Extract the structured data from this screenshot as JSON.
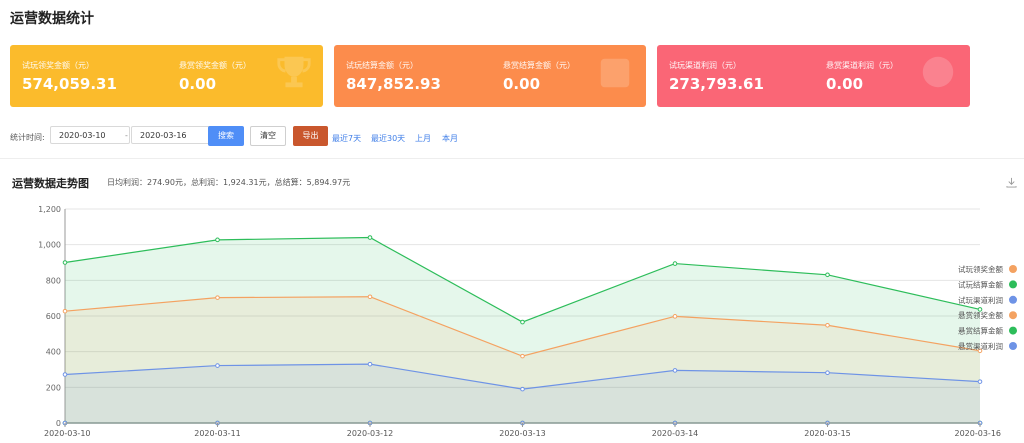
{
  "page_title": "运营数据统计",
  "cards": [
    {
      "items": [
        {
          "label": "试玩领奖金额（元）",
          "value": "574,059.31"
        },
        {
          "label": "悬赏领奖金额（元）",
          "value": "0.00"
        }
      ]
    },
    {
      "items": [
        {
          "label": "试玩结算金额（元）",
          "value": "847,852.93"
        },
        {
          "label": "悬赏结算金额（元）",
          "value": "0.00"
        }
      ]
    },
    {
      "items": [
        {
          "label": "试玩渠道利润（元）",
          "value": "273,793.61"
        },
        {
          "label": "悬赏渠道利润（元）",
          "value": "0.00"
        }
      ]
    }
  ],
  "filter": {
    "label": "统计时间:",
    "start_date": "2020-03-10",
    "separator": "-",
    "end_date": "2020-03-16",
    "search": "搜索",
    "clear": "清空",
    "export": "导出",
    "quick_links": [
      "最近7天",
      "最近30天",
      "上月",
      "本月"
    ]
  },
  "chart_section": {
    "title": "运营数据走势图",
    "summary": "日均利润：274.90元，总利润：1,924.31元，总结算：5,894.97元"
  },
  "chart_data": {
    "type": "area",
    "categories": [
      "2020-03-10",
      "2020-03-11",
      "2020-03-12",
      "2020-03-13",
      "2020-03-14",
      "2020-03-15",
      "2020-03-16"
    ],
    "ylim": [
      0,
      1200
    ],
    "yticks": [
      0,
      200,
      400,
      600,
      800,
      1000,
      1200
    ],
    "ytick_labels": [
      "0",
      "200",
      "400",
      "600",
      "800",
      "1,000",
      "1,200"
    ],
    "grid": true,
    "legend_position": "right",
    "series": [
      {
        "name": "试玩领奖金额",
        "color": "#f4a261",
        "values": [
          627,
          703,
          708,
          375,
          598,
          548,
          405
        ]
      },
      {
        "name": "试玩结算金额",
        "color": "#2dbd5a",
        "values": [
          900,
          1027,
          1040,
          566,
          894,
          831,
          637
        ]
      },
      {
        "name": "试玩渠道利润",
        "color": "#6e93e6",
        "values": [
          272,
          322,
          330,
          190,
          295,
          282,
          232
        ]
      },
      {
        "name": "悬赏领奖金额",
        "color": "#f4a261",
        "values": [
          0,
          0,
          0,
          0,
          0,
          0,
          0
        ]
      },
      {
        "name": "悬赏结算金额",
        "color": "#2dbd5a",
        "values": [
          0,
          0,
          0,
          0,
          0,
          0,
          0
        ]
      },
      {
        "name": "悬赏渠道利润",
        "color": "#6e93e6",
        "values": [
          0,
          0,
          0,
          0,
          0,
          0,
          0
        ]
      }
    ]
  }
}
